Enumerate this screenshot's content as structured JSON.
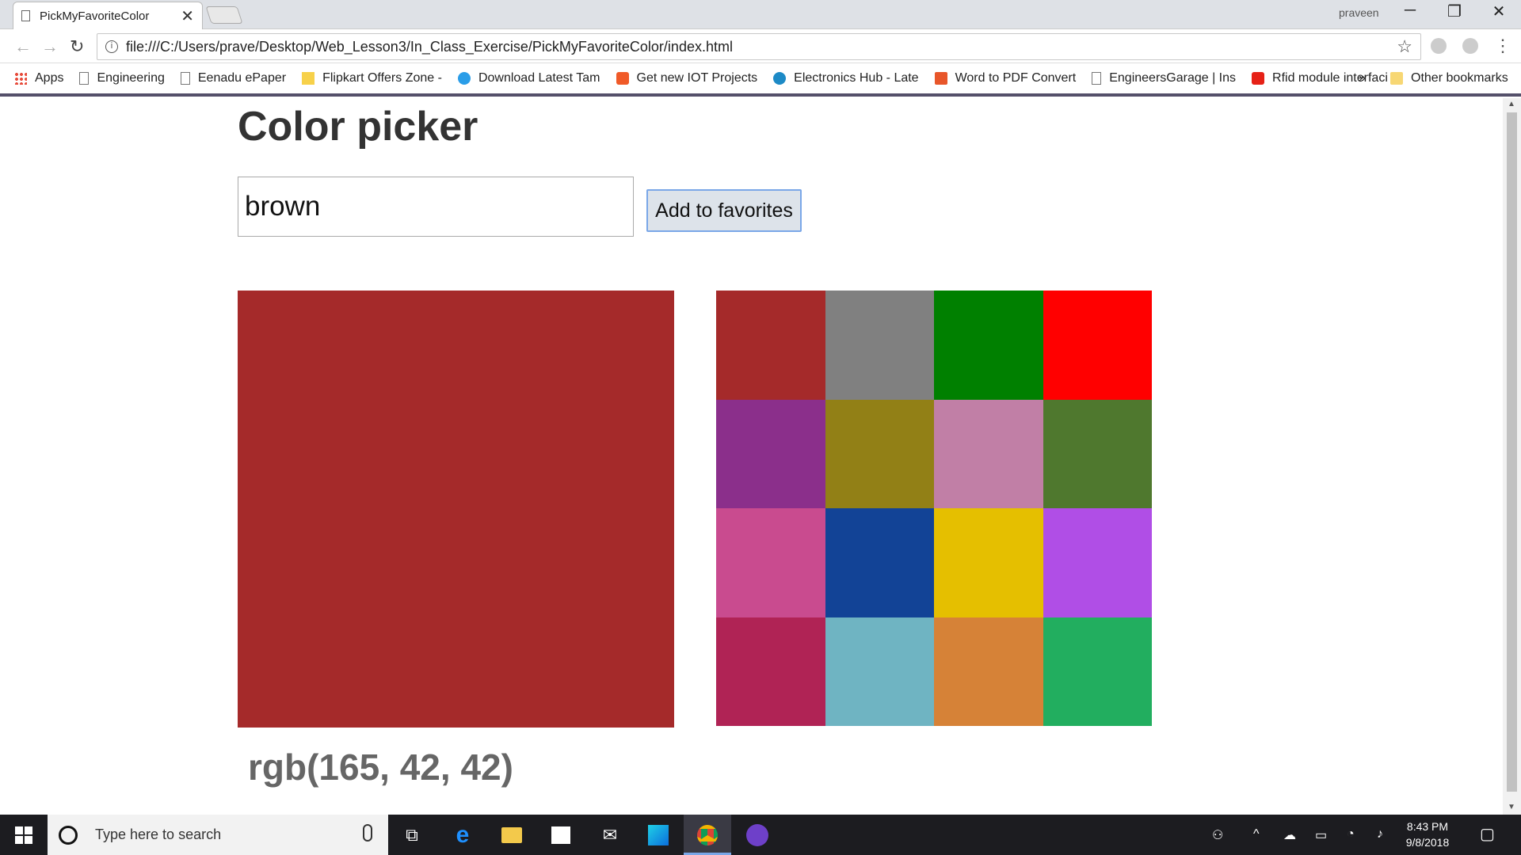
{
  "browser": {
    "tab_title": "PickMyFavoriteColor",
    "tab_close": "✕",
    "user": "praveen",
    "url": "file:///C:/Users/prave/Desktop/Web_Lesson3/In_Class_Exercise/PickMyFavoriteColor/index.html",
    "bookmarks": [
      {
        "label": "Apps",
        "icon": "apps-grid-icon",
        "color": "#e74c3c"
      },
      {
        "label": "Engineering",
        "icon": "page-icon",
        "color": "#777"
      },
      {
        "label": "Eenadu ePaper",
        "icon": "page-icon",
        "color": "#777"
      },
      {
        "label": "Flipkart Offers Zone -",
        "icon": "flipkart-icon",
        "color": "#f7d14a"
      },
      {
        "label": "Download Latest Tam",
        "icon": "play-icon",
        "color": "#2a9de8"
      },
      {
        "label": "Get new IOT Projects",
        "icon": "iot-icon",
        "color": "#f05a28"
      },
      {
        "label": "Electronics Hub - Late",
        "icon": "e-icon",
        "color": "#1d8ac6"
      },
      {
        "label": "Word to PDF Convert",
        "icon": "pdf-icon",
        "color": "#e8562a"
      },
      {
        "label": "EngineersGarage | Ins",
        "icon": "page-icon",
        "color": "#777"
      },
      {
        "label": "Rfid module interfaci",
        "icon": "youtube-icon",
        "color": "#e62117"
      }
    ],
    "bookmarks_more": "»",
    "other_bookmarks": "Other bookmarks"
  },
  "page": {
    "title": "Color picker",
    "input_value": "brown",
    "add_button": "Add to favorites",
    "current_color": "#a52a2a",
    "rgb_text": "rgb(165, 42, 42)",
    "favorites": [
      "#a52a2a",
      "#808080",
      "#008000",
      "#ff0000",
      "#8b2f8b",
      "#928016",
      "#c17fa6",
      "#4f782e",
      "#c94b8f",
      "#124396",
      "#e5bf00",
      "#b04ee6",
      "#b02355",
      "#6fb4c2",
      "#d68237",
      "#22ae5f"
    ]
  },
  "taskbar": {
    "search_placeholder": "Type here to search",
    "time": "8:43 PM",
    "date": "9/8/2018"
  }
}
